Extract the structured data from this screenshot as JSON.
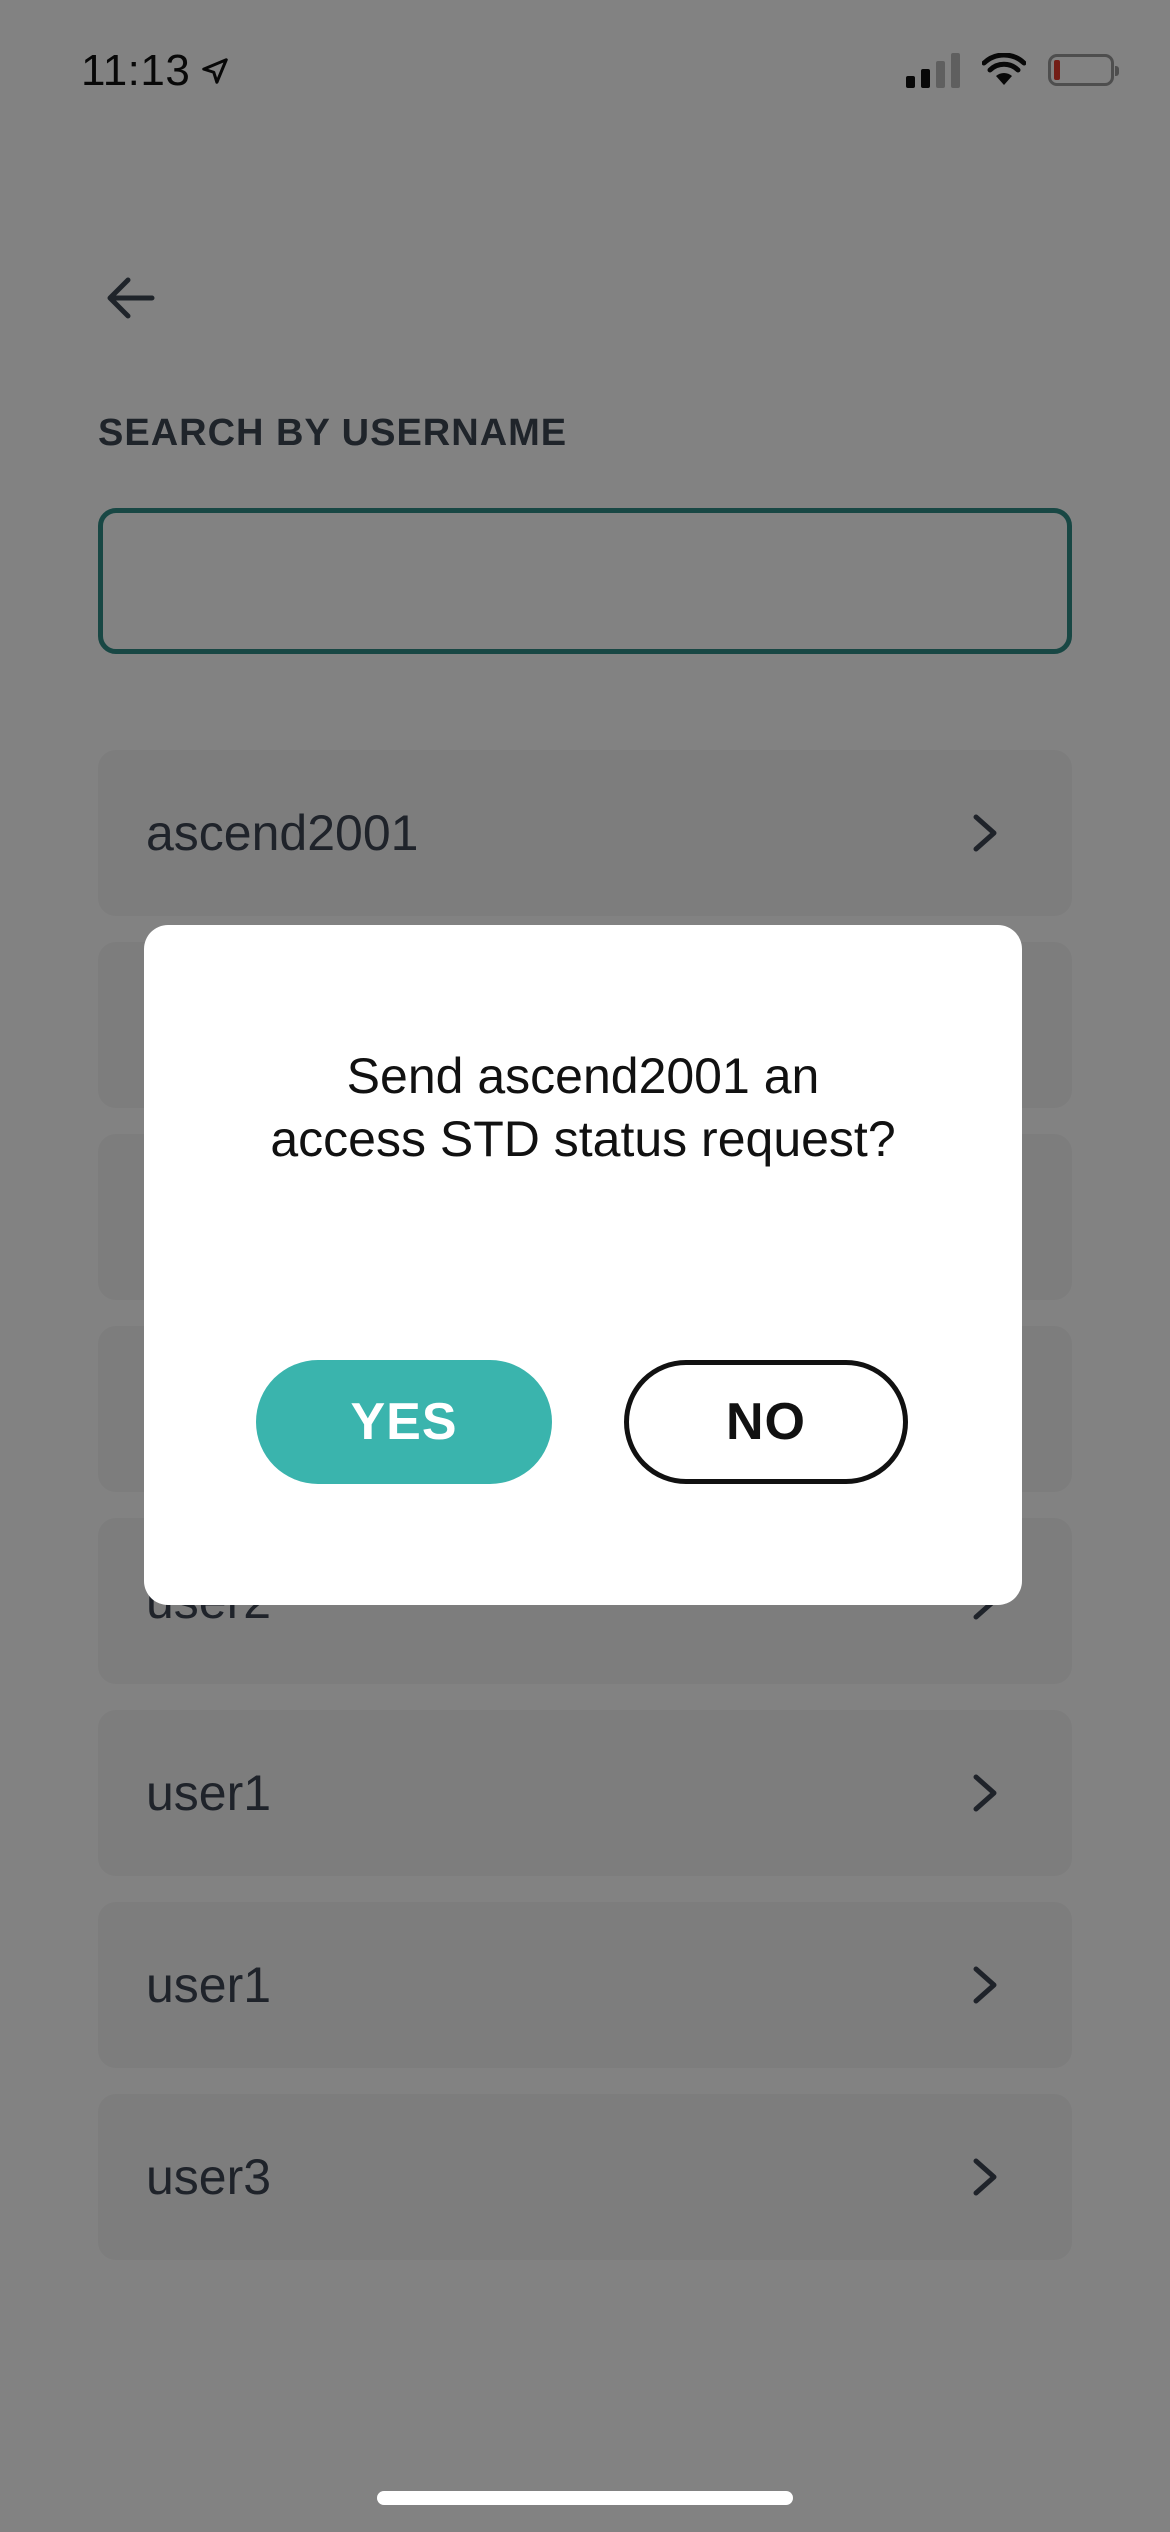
{
  "status_bar": {
    "time": "11:13",
    "location_icon": "location-arrow-icon",
    "signal_icon": "cellular-signal-icon",
    "wifi_icon": "wifi-icon",
    "battery_icon": "battery-low-icon",
    "battery_color": "#e23b2e"
  },
  "header": {
    "back_icon": "back-arrow-icon"
  },
  "search": {
    "label": "SEARCH BY USERNAME",
    "value": "",
    "accent_color": "#2f8b85"
  },
  "results": [
    {
      "username": "ascend2001"
    },
    {
      "username": ""
    },
    {
      "username": ""
    },
    {
      "username": ""
    },
    {
      "username": "user2"
    },
    {
      "username": "user1"
    },
    {
      "username": "user1"
    },
    {
      "username": "user3"
    }
  ],
  "dialog": {
    "message": "Send ascend2001 an access STD status request?",
    "yes_label": "YES",
    "no_label": "NO",
    "yes_color": "#3ab4ad"
  }
}
